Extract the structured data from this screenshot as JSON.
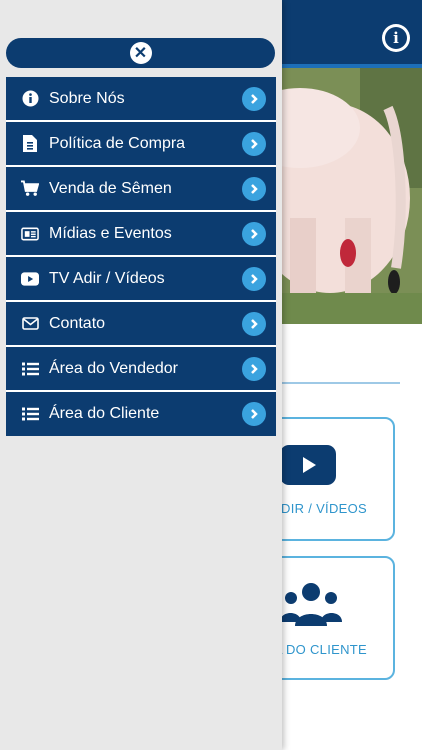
{
  "drawer": {
    "close_icon": "close-icon",
    "items": [
      {
        "label": "Sobre Nós",
        "icon": "info-icon"
      },
      {
        "label": "Política de Compra",
        "icon": "document-icon"
      },
      {
        "label": "Venda de Sêmen",
        "icon": "cart-icon"
      },
      {
        "label": "Mídias e Eventos",
        "icon": "newspaper-icon"
      },
      {
        "label": "TV Adir / Vídeos",
        "icon": "youtube-icon"
      },
      {
        "label": "Contato",
        "icon": "envelope-icon"
      },
      {
        "label": "Área do Vendedor",
        "icon": "list-icon"
      },
      {
        "label": "Área do Cliente",
        "icon": "list-icon"
      }
    ]
  },
  "background": {
    "tiles": [
      {
        "label": "DIR / VÍDEOS",
        "icon": "youtube-icon"
      },
      {
        "label": "A DO CLIENTE",
        "icon": "users-icon"
      }
    ]
  },
  "colors": {
    "primary": "#0c3c70",
    "accent": "#3aa3df",
    "tile_border": "#5bb3df"
  }
}
